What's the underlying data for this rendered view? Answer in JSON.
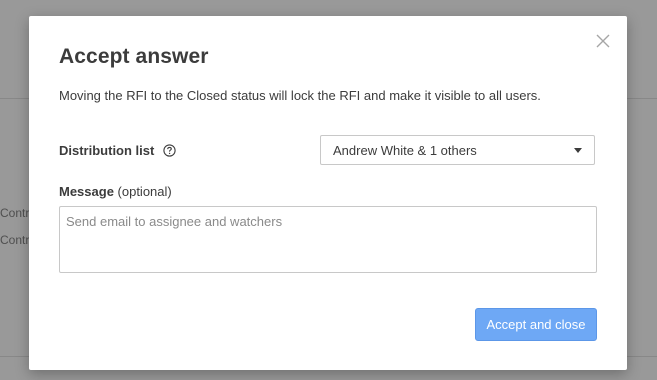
{
  "background": {
    "snippets": [
      "Contr",
      "Contr"
    ]
  },
  "dialog": {
    "title": "Accept answer",
    "description": "Moving the RFI to the Closed status will lock the RFI and make it visible to all users.",
    "close_icon": "close-icon",
    "distribution": {
      "label": "Distribution list",
      "help_icon": "question-circle-icon",
      "selected": "Andrew White & 1 others"
    },
    "message": {
      "label": "Message",
      "optional": " (optional)",
      "placeholder": "Send email to assignee and watchers"
    },
    "primary_button": "Accept and close"
  },
  "colors": {
    "primary": "#6ea8f5",
    "text": "#3c3c3c",
    "border": "#c8c8c8"
  }
}
